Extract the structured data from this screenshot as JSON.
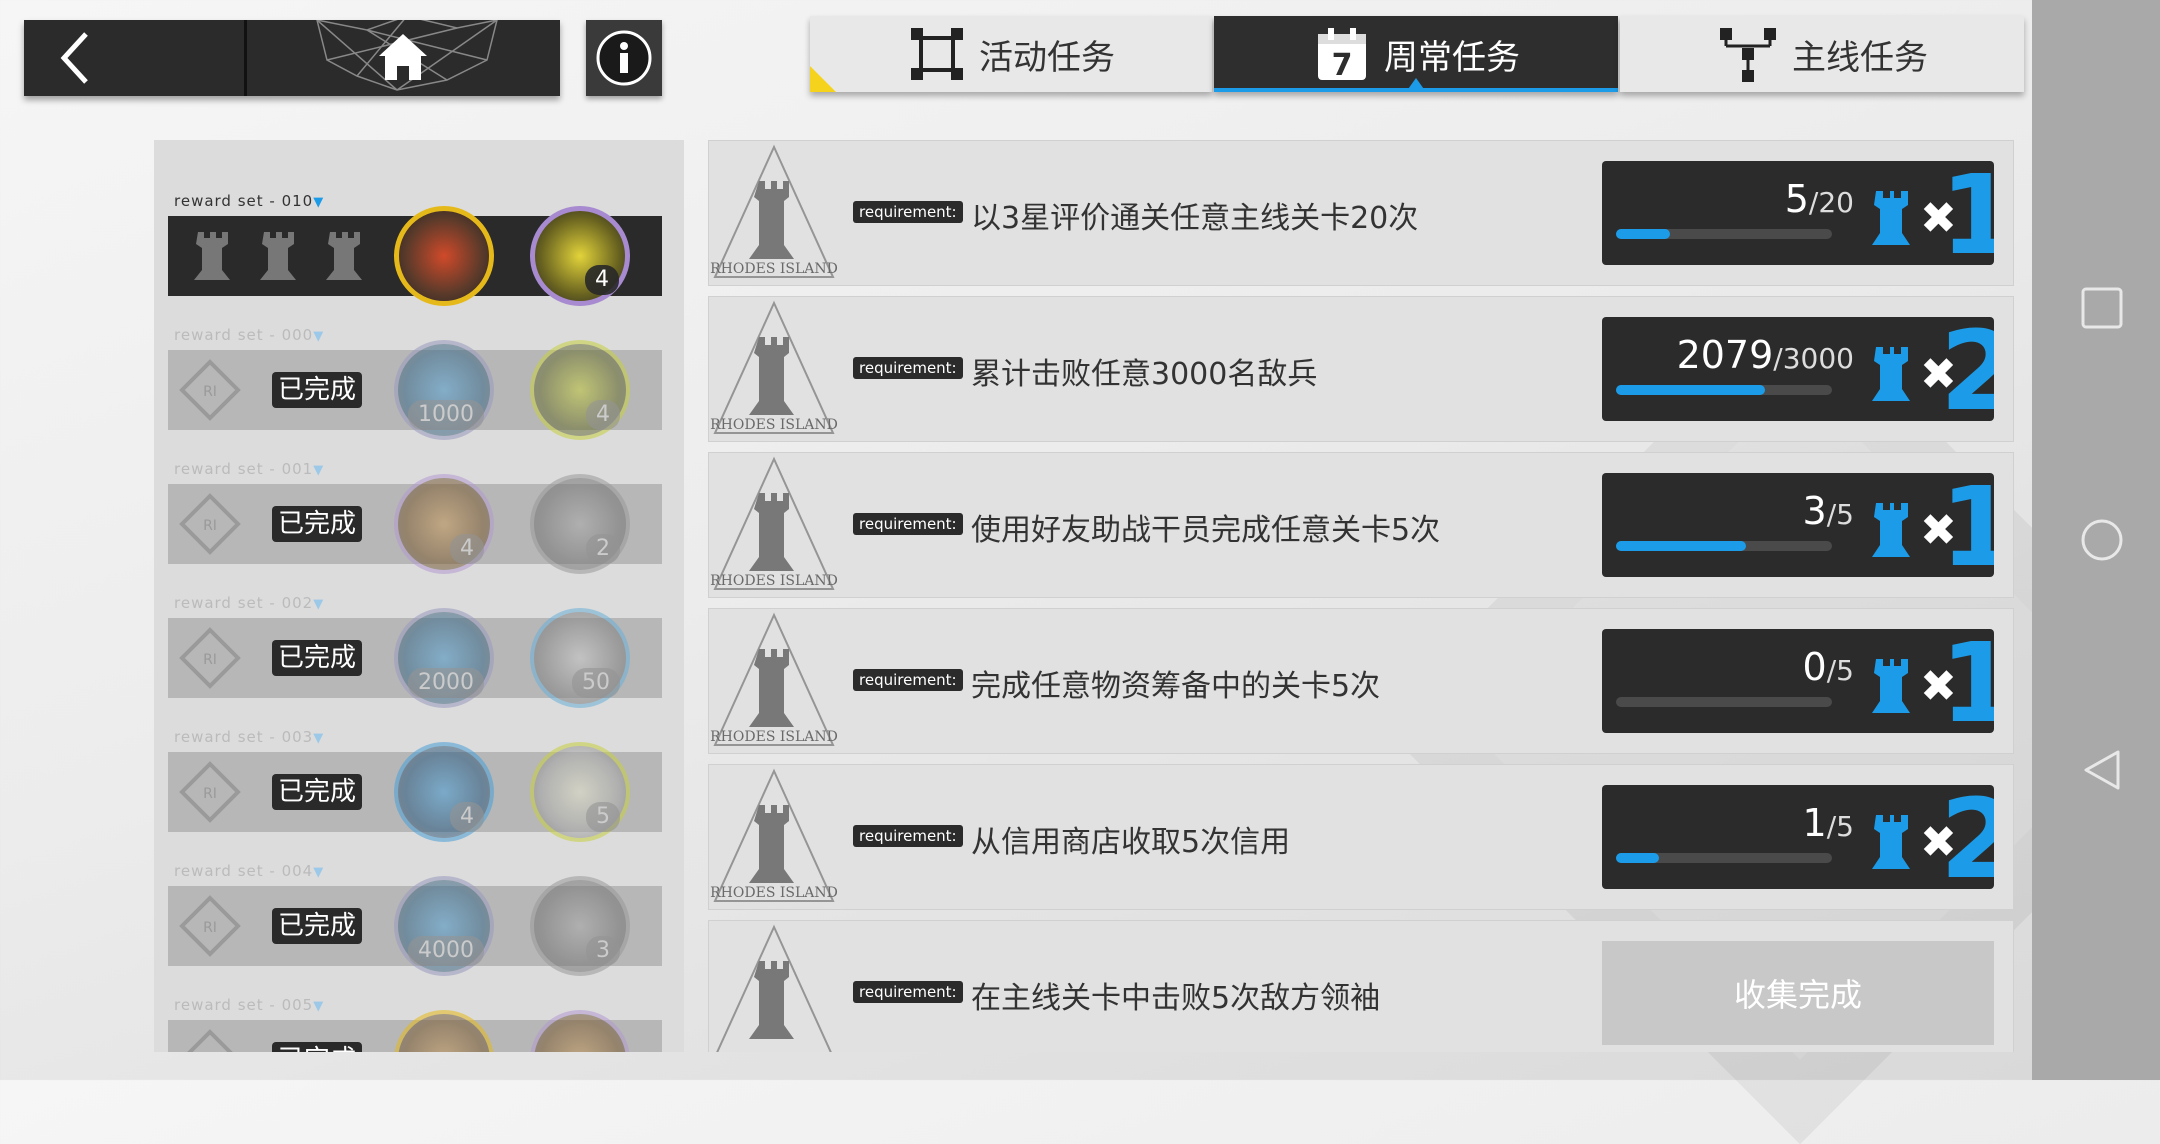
{
  "tabs": [
    {
      "label": "活动任务",
      "icon": "focus-frame-icon",
      "active": false
    },
    {
      "label": "周常任务",
      "icon": "calendar-7-icon",
      "active": true
    },
    {
      "label": "主线任务",
      "icon": "tree-structure-icon",
      "active": false
    }
  ],
  "tab_calendar_number": "7",
  "reward_sets": [
    {
      "label": "reward set - 010",
      "completed": false,
      "items": [
        {
          "qty": ""
        },
        {
          "qty": "4"
        }
      ]
    },
    {
      "label": "reward set - 000",
      "completed": true,
      "done_text": "已完成",
      "items": [
        {
          "qty": "1000"
        },
        {
          "qty": "4"
        }
      ]
    },
    {
      "label": "reward set - 001",
      "completed": true,
      "done_text": "已完成",
      "items": [
        {
          "qty": "4"
        },
        {
          "qty": "2"
        }
      ]
    },
    {
      "label": "reward set - 002",
      "completed": true,
      "done_text": "已完成",
      "items": [
        {
          "qty": "2000"
        },
        {
          "qty": "50"
        }
      ]
    },
    {
      "label": "reward set - 003",
      "completed": true,
      "done_text": "已完成",
      "items": [
        {
          "qty": "4"
        },
        {
          "qty": "5"
        }
      ]
    },
    {
      "label": "reward set - 004",
      "completed": true,
      "done_text": "已完成",
      "items": [
        {
          "qty": "4000"
        },
        {
          "qty": "3"
        }
      ]
    },
    {
      "label": "reward set - 005",
      "completed": true,
      "done_text": "已完成",
      "items": [
        {
          "qty": ""
        },
        {
          "qty": ""
        }
      ]
    }
  ],
  "tasks": [
    {
      "requirement_tag": "requirement:",
      "text": "以3星评价通关任意主线关卡20次",
      "current": "5",
      "sep": "/",
      "total": "20",
      "progress": 0.25,
      "mult": "1",
      "x": "✖"
    },
    {
      "requirement_tag": "requirement:",
      "text": "累计击败任意3000名敌兵",
      "current": "2079",
      "sep": "/",
      "total": "3000",
      "progress": 0.69,
      "mult": "2",
      "x": "✖"
    },
    {
      "requirement_tag": "requirement:",
      "text": "使用好友助战干员完成任意关卡5次",
      "current": "3",
      "sep": "/",
      "total": "5",
      "progress": 0.6,
      "mult": "1",
      "x": "✖"
    },
    {
      "requirement_tag": "requirement:",
      "text": "完成任意物资筹备中的关卡5次",
      "current": "0",
      "sep": "/",
      "total": "5",
      "progress": 0.0,
      "mult": "1",
      "x": "✖"
    },
    {
      "requirement_tag": "requirement:",
      "text": "从信用商店收取5次信用",
      "current": "1",
      "sep": "/",
      "total": "5",
      "progress": 0.2,
      "mult": "2",
      "x": "✖"
    },
    {
      "requirement_tag": "requirement:",
      "text": "在主线关卡中击败5次敌方领袖",
      "collect_text": "收集完成"
    }
  ],
  "logo_text": "RHODES ISLAND",
  "colors": {
    "accent": "#1c9ce8",
    "dark": "#2b2b2b",
    "highlight": "#f5d21c"
  }
}
